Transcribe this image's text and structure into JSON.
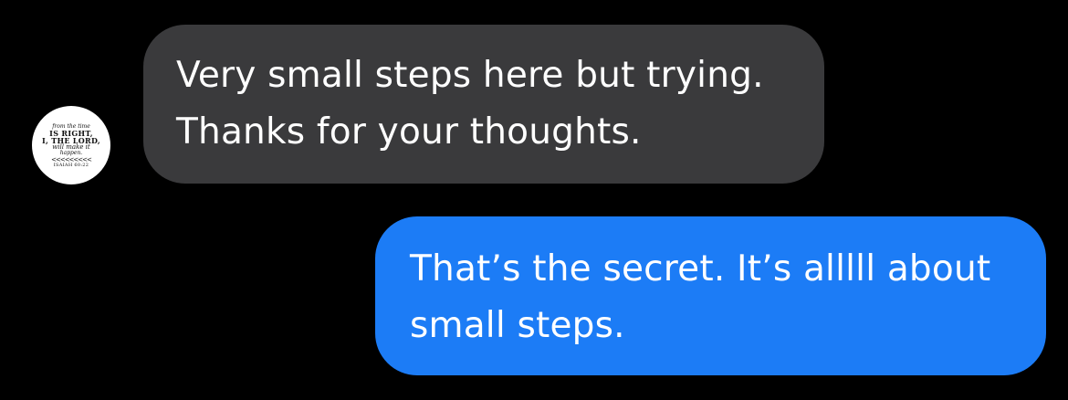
{
  "conversation": {
    "contact": {
      "avatar_text": {
        "line1": "from the time",
        "line2": "IS RIGHT,",
        "line3": "I, THE LORD,",
        "line4": "will make it",
        "line5": "happen.",
        "line6": "ISAIAH 60:22"
      }
    },
    "messages": [
      {
        "direction": "incoming",
        "lines": [
          "Very small steps here but trying.",
          "Thanks for your thoughts."
        ]
      },
      {
        "direction": "outgoing",
        "lines": [
          "That’s the secret. It’s alllll about",
          "small steps."
        ]
      }
    ]
  },
  "colors": {
    "background": "#000000",
    "incoming_bubble": "#3a3a3c",
    "outgoing_bubble": "#1c7cf6",
    "text": "#ffffff"
  }
}
